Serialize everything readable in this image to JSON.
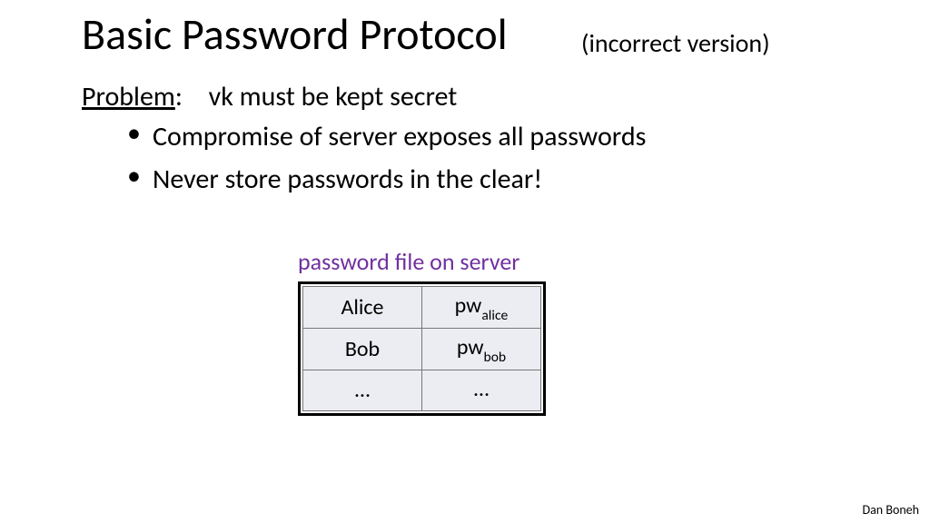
{
  "title": "Basic Password Protocol",
  "subtitle": "(incorrect version)",
  "problem": {
    "label": "Problem",
    "text": "vk must be kept secret"
  },
  "bullets": [
    "Compromise of server exposes all passwords",
    "Never store passwords in the clear!"
  ],
  "table": {
    "caption": "password file on server",
    "rows": [
      {
        "name": "Alice",
        "pw_prefix": "pw",
        "pw_sub": "alice"
      },
      {
        "name": "Bob",
        "pw_prefix": "pw",
        "pw_sub": "bob"
      },
      {
        "name": "…",
        "pw_prefix": "…",
        "pw_sub": ""
      }
    ]
  },
  "footer": "Dan Boneh"
}
